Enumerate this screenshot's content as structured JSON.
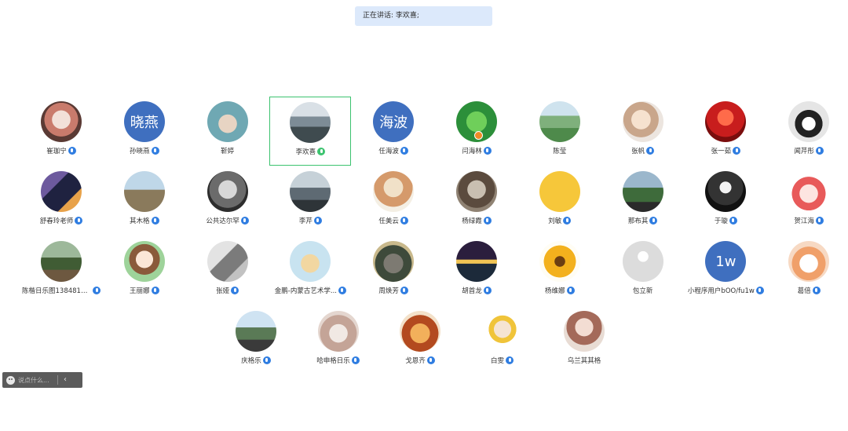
{
  "speaking": {
    "label": "正在讲话:",
    "names": "李欢喜;"
  },
  "chat": {
    "placeholder": "说点什么...",
    "collapse_icon": "chevron-left-icon"
  },
  "colors": {
    "accent": "#2f7de1",
    "active_border": "#3cc36f",
    "banner_bg": "#dce9fb"
  },
  "participants": [
    {
      "name": "崔珈宁",
      "avatar": "photo-helmet",
      "mic": "active"
    },
    {
      "name": "孙晓燕",
      "avatar_text": "晓燕",
      "avatar": "text-blue",
      "mic": "active"
    },
    {
      "name": "靳婷",
      "avatar": "photo-cat-illustration",
      "mic": "none"
    },
    {
      "name": "李欢喜",
      "avatar": "photo-mountains",
      "mic": "speaking",
      "active": true
    },
    {
      "name": "任海波",
      "avatar_text": "海波",
      "avatar": "text-blue",
      "mic": "active"
    },
    {
      "name": "闫海林",
      "avatar": "photo-clover",
      "mic": "active",
      "badge": true
    },
    {
      "name": "陈莹",
      "avatar": "photo-hills",
      "mic": "none"
    },
    {
      "name": "张帆",
      "avatar": "photo-girl-dog",
      "mic": "active"
    },
    {
      "name": "张一茹",
      "avatar": "photo-red-dancer",
      "mic": "active"
    },
    {
      "name": "闻芹彤",
      "avatar": "photo-penguin",
      "mic": "active"
    },
    {
      "name": "舒春玲老师",
      "avatar": "photo-night-road",
      "mic": "active"
    },
    {
      "name": "其木格",
      "avatar": "photo-landscape-person",
      "mic": "active"
    },
    {
      "name": "公共达尔罕",
      "avatar": "photo-elder-bw",
      "mic": "active"
    },
    {
      "name": "李芹",
      "avatar": "photo-sunset-silhouette",
      "mic": "active"
    },
    {
      "name": "任美云",
      "avatar": "photo-painting-lady",
      "mic": "active"
    },
    {
      "name": "杨绿霞",
      "avatar": "photo-braids",
      "mic": "active"
    },
    {
      "name": "刘敏",
      "avatar": "photo-smiley",
      "mic": "active"
    },
    {
      "name": "那布其",
      "avatar": "photo-sports-field",
      "mic": "active"
    },
    {
      "name": "于璇",
      "avatar": "photo-dark-figure",
      "mic": "active"
    },
    {
      "name": "贺江海",
      "avatar": "photo-cartoon-girl",
      "mic": "active"
    },
    {
      "name": "陈楷日乐图1384815...",
      "avatar": "photo-outdoor-people",
      "mic": "active"
    },
    {
      "name": "王丽娜",
      "avatar": "photo-cartoon-woman",
      "mic": "active"
    },
    {
      "name": "张娅",
      "avatar": "photo-sketch-art",
      "mic": "active"
    },
    {
      "name": "金鹏-内蒙古艺术学...",
      "avatar": "photo-shiba-cartoon",
      "mic": "active"
    },
    {
      "name": "周焕芳",
      "avatar": "photo-totoro",
      "mic": "active"
    },
    {
      "name": "胡首龙",
      "avatar": "photo-moon-lake",
      "mic": "active"
    },
    {
      "name": "杨维娜",
      "avatar": "photo-sunflower",
      "mic": "active"
    },
    {
      "name": "包立新",
      "avatar": "photo-default-user",
      "mic": "none"
    },
    {
      "name": "小程序用户bOO/fu1w",
      "avatar_text": "1w",
      "avatar": "text-blue",
      "mic": "active"
    },
    {
      "name": "葛倍",
      "avatar": "photo-cartoon-dog",
      "mic": "active"
    },
    {
      "name": "庆格乐",
      "avatar": "photo-hiker",
      "mic": "active"
    },
    {
      "name": "哈申格日乐",
      "avatar": "photo-tea-cup",
      "mic": "active"
    },
    {
      "name": "戈恩齐",
      "avatar": "photo-tiger-cartoon",
      "mic": "active"
    },
    {
      "name": "白雯",
      "avatar": "photo-girl-headphones",
      "mic": "active"
    },
    {
      "name": "乌兰其其格",
      "avatar": "photo-woman-portrait",
      "mic": "none"
    }
  ]
}
